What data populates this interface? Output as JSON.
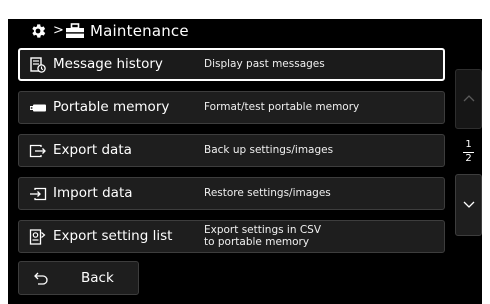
{
  "header": {
    "separator": ">",
    "title": "Maintenance",
    "gear_icon": "gear-icon",
    "tool_icon": "toolbox-icon"
  },
  "menu": [
    {
      "label": "Message history",
      "description": "Display past messages",
      "icon": "message-history-icon",
      "selected": true
    },
    {
      "label": "Portable memory",
      "description": "Format/test portable memory",
      "icon": "portable-memory-icon",
      "selected": false
    },
    {
      "label": "Export data",
      "description": "Back up settings/images",
      "icon": "export-icon",
      "selected": false
    },
    {
      "label": "Import data",
      "description": "Restore settings/images",
      "icon": "import-icon",
      "selected": false
    },
    {
      "label": "Export setting list",
      "description_line1": "Export settings in CSV",
      "description_line2": "to portable memory",
      "icon": "export-setting-list-icon",
      "selected": false
    }
  ],
  "pager": {
    "current": "1",
    "total": "2"
  },
  "back": {
    "label": "Back",
    "icon": "back-arrow-icon"
  },
  "colors": {
    "background": "#000000",
    "button": "#1e1e1e",
    "selected_border": "#ffffff",
    "text": "#ffffff"
  }
}
